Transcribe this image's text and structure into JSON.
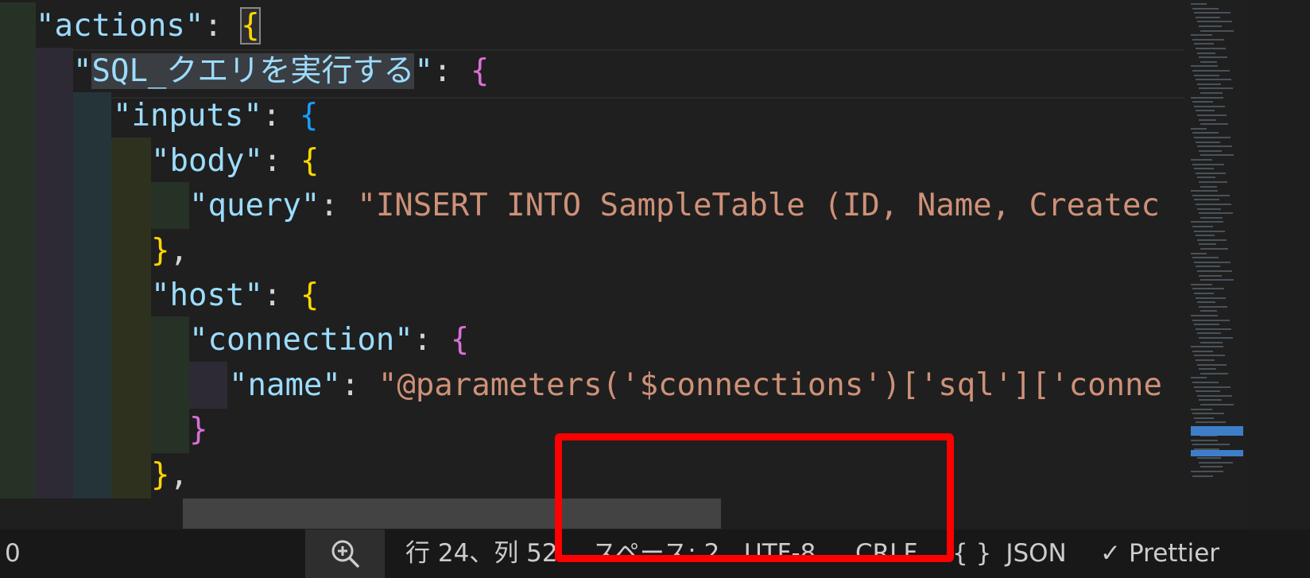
{
  "code_lines": [
    {
      "parts": [
        {
          "t": "\"actions\"",
          "c": "k"
        },
        {
          "t": ": ",
          "c": "p"
        },
        {
          "t": "{",
          "c": "b1 bracket-box"
        }
      ]
    },
    {
      "parts": [
        {
          "t": "\"",
          "c": "k"
        },
        {
          "t": "SQL_クエリを実行する",
          "c": "k sel"
        },
        {
          "t": "\"",
          "c": "k"
        },
        {
          "t": ": ",
          "c": "p"
        },
        {
          "t": "{",
          "c": "b2"
        }
      ]
    },
    {
      "parts": [
        {
          "t": "\"inputs\"",
          "c": "k"
        },
        {
          "t": ": ",
          "c": "p"
        },
        {
          "t": "{",
          "c": "b3"
        }
      ]
    },
    {
      "parts": [
        {
          "t": "\"body\"",
          "c": "k"
        },
        {
          "t": ": ",
          "c": "p"
        },
        {
          "t": "{",
          "c": "b1"
        }
      ]
    },
    {
      "parts": [
        {
          "t": "\"query\"",
          "c": "k"
        },
        {
          "t": ": ",
          "c": "p"
        },
        {
          "t": "\"INSERT INTO SampleTable (ID, Name, Createc",
          "c": "s"
        }
      ]
    },
    {
      "parts": [
        {
          "t": "}",
          "c": "b1"
        },
        {
          "t": ",",
          "c": "p"
        }
      ]
    },
    {
      "parts": [
        {
          "t": "\"host\"",
          "c": "k"
        },
        {
          "t": ": ",
          "c": "p"
        },
        {
          "t": "{",
          "c": "b1"
        }
      ]
    },
    {
      "parts": [
        {
          "t": "\"connection\"",
          "c": "k"
        },
        {
          "t": ": ",
          "c": "p"
        },
        {
          "t": "{",
          "c": "b2"
        }
      ]
    },
    {
      "parts": [
        {
          "t": "\"name\"",
          "c": "k"
        },
        {
          "t": ": ",
          "c": "p"
        },
        {
          "t": "\"@parameters('$connections')['sql']['conne",
          "c": "s"
        }
      ]
    },
    {
      "parts": [
        {
          "t": "}",
          "c": "b2"
        }
      ]
    },
    {
      "parts": [
        {
          "t": "}",
          "c": "b1"
        },
        {
          "t": ",",
          "c": "p"
        }
      ]
    }
  ],
  "status_bar": {
    "left_text": "0",
    "zoom_icon": "zoom-in-icon",
    "cursor_position": "行 24、列 52",
    "indentation": "スペース: 2",
    "encoding": "UTF-8",
    "line_ending": "CRLF",
    "language_icon": "{ }",
    "language": "JSON",
    "formatter_icon": "✓",
    "formatter": "Prettier"
  },
  "colors": {
    "editor_bg": "#1f1f1f",
    "key": "#9cdcfe",
    "string": "#ce9178",
    "bracket_gold": "#ffd700",
    "bracket_orchid": "#da70d6",
    "bracket_blue": "#179fff",
    "annotation_red": "#ff0000"
  }
}
